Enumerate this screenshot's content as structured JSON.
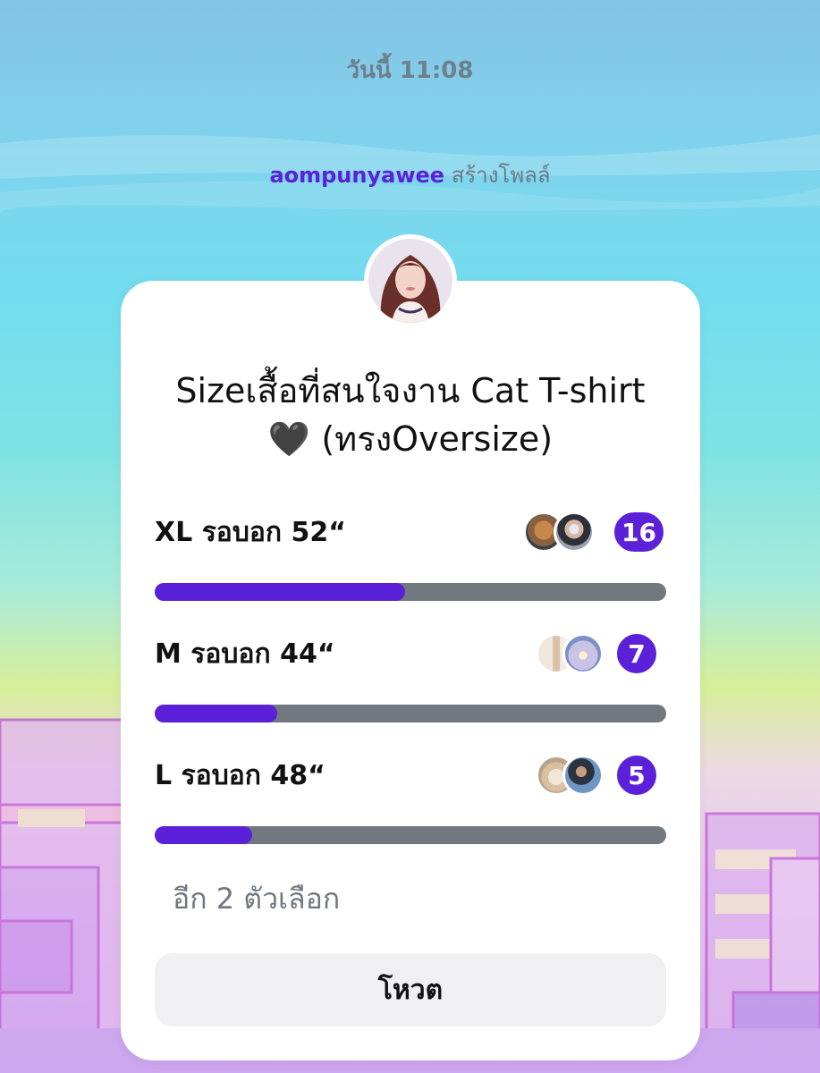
{
  "header": {
    "timestamp": "วันนี้ 11:08",
    "creator_name": "aompunyawee",
    "creator_action": "สร้างโพลล์"
  },
  "poll": {
    "title": "Sizeเสื้อที่สนใจงาน Cat T-shirt🖤 (ทรงOversize)",
    "options": [
      {
        "label": "XL รอบอก 52“",
        "votes": "16",
        "fill_fraction": 0.49,
        "voter_icons": [
          "teddy-bear-avatar-icon",
          "man-with-mask-avatar-icon"
        ]
      },
      {
        "label": "M รอบอก 44“",
        "votes": "7",
        "fill_fraction": 0.24,
        "voter_icons": [
          "room-avatar-icon",
          "sunset-avatar-icon"
        ]
      },
      {
        "label": "L รอบอก 48“",
        "votes": "5",
        "fill_fraction": 0.19,
        "voter_icons": [
          "cat-avatar-icon",
          "man-outdoor-avatar-icon"
        ]
      }
    ],
    "more_options": "อีก 2 ตัวเลือก",
    "vote_button": "โหวต"
  },
  "colors": {
    "accent": "#5b21d9",
    "bar_track": "#727880",
    "card": "#ffffff",
    "button_bg": "#f0f0f3"
  }
}
